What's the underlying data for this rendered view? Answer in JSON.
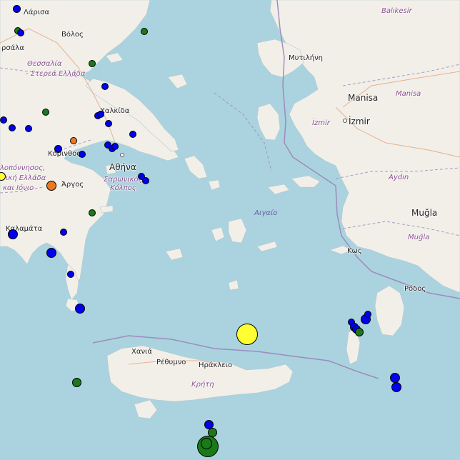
{
  "map": {
    "sea_color": "#aad3df",
    "land_color": "#f2efe9",
    "labels": {
      "larisa": "Λάρισα",
      "volos": "Βόλος",
      "farsala": "ρσάλα",
      "thessalia": "Θεσσαλία",
      "sterea": "- Στερεά Ελλάδα",
      "chalkida": "Χαλκίδα",
      "korinthos": "Κόρινθος",
      "athina": "Αθήνα",
      "saronikos1": "Σαρωνικός",
      "saronikos2": "Κόλπος",
      "peloponnisos": "λοπόννησος,",
      "dytiki": "ική Ελλάδα",
      "ionio": "και Ιόνιο",
      "argos": "Άργος",
      "kalamata": "Καλαμάτα",
      "mytilini": "Μυτιλήνη",
      "balikesir": "Balıkesir",
      "manisa_city": "Manisa",
      "manisa_region": "Manisa",
      "izmir_city": "İzmir",
      "izmir_region": "İzmir",
      "aydin": "Aydın",
      "mugla_city": "Muğla",
      "mugla_region": "Muğla",
      "aigaio": "Αιγαίο",
      "kos": "Κως",
      "rodos": "Ρόδος",
      "chania": "Χανιά",
      "rethymno": "Ρέθυμνο",
      "irakleio": "Ηράκλειο",
      "kriti": "Κρήτη"
    },
    "legend_colors": {
      "blue": "#0000ee",
      "green": "#1a7a1a",
      "orange": "#ee7722",
      "yellow": "#ffff33"
    }
  }
}
